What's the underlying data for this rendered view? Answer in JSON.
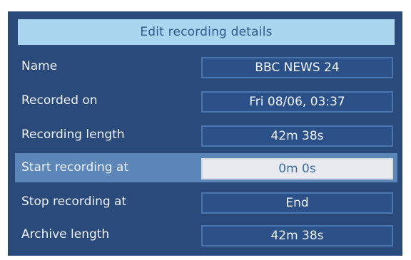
{
  "dialog": {
    "title": "Edit recording details",
    "rows": [
      {
        "label": "Name",
        "value": "BBC NEWS 24"
      },
      {
        "label": "Recorded on",
        "value": "Fri 08/06, 03:37"
      },
      {
        "label": "Recording length",
        "value": "42m 38s"
      },
      {
        "label": "Start recording at",
        "value": "0m 0s"
      },
      {
        "label": "Stop recording at",
        "value": "End"
      },
      {
        "label": "Archive length",
        "value": "42m 38s"
      }
    ]
  }
}
